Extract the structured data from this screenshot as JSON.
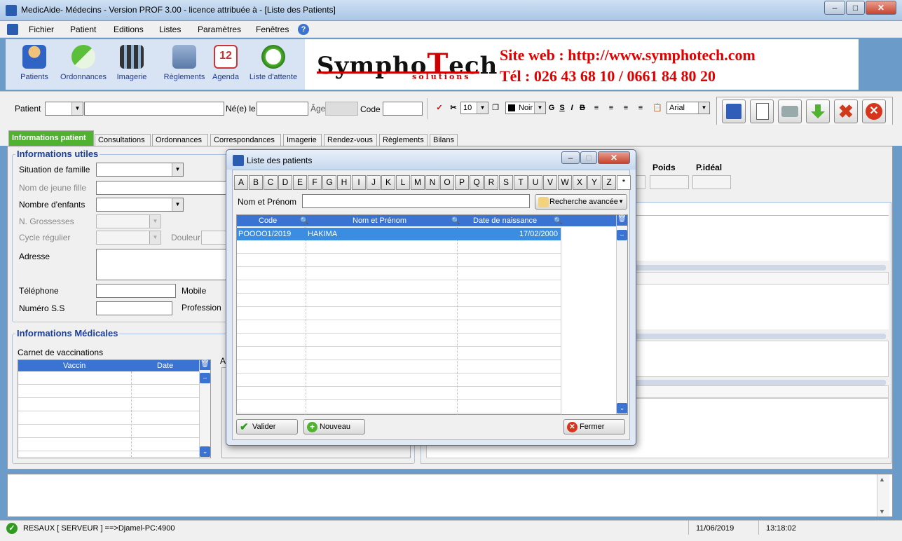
{
  "window": {
    "title": "MedicAide- Médecins - Version PROF 3.00 - licence attribuée à  - [Liste des Patients]"
  },
  "menu": [
    "Fichier",
    "Patient",
    "Editions",
    "Listes",
    "Paramètres",
    "Fenêtres"
  ],
  "toolbar": [
    "Patients",
    "Ordonnances",
    "Imagerie",
    "Règlements",
    "Agenda",
    "Liste d'attente"
  ],
  "banner": {
    "logo_main": "SymphoTech",
    "logo_sub": "solutions",
    "website": "Site web : http://www.symphotech.com",
    "phone": "Tél : 026 43 68 10 / 0661 84 80 20"
  },
  "patient_bar": {
    "patient_label": "Patient",
    "born_label": "Né(e) le",
    "age_label": "Âge",
    "code_label": "Code"
  },
  "format_bar": {
    "font_size": "10",
    "color": "Noir",
    "font": "Arial",
    "bold": "G",
    "underline": "S",
    "italic": "I",
    "strike": "B"
  },
  "tabs": [
    "Informations patient",
    "Consultations",
    "Ordonnances",
    "Correspondances",
    "Imagerie",
    "Rendez-vous",
    "Règlements",
    "Bilans"
  ],
  "info_utiles": {
    "title": "Informations utiles",
    "situation": "Situation de famille",
    "nom_jeune_fille": "Nom de jeune fille",
    "nombre_enfants": "Nombre d'enfants",
    "grossesses": "N. Grossesses",
    "cycle": "Cycle régulier",
    "douleur": "Douleur",
    "adresse": "Adresse",
    "telephone": "Téléphone",
    "mobile": "Mobile",
    "numero_ss": "Numéro S.S",
    "profession": "Profession"
  },
  "right_labels": {
    "poids": "Poids",
    "pideal": "P.idéal"
  },
  "info_medicales": {
    "title": "Informations Médicales",
    "carnet": "Carnet de vaccinations",
    "col_vaccin": "Vaccin",
    "col_date": "Date",
    "a_label": "A"
  },
  "dialog": {
    "title": "Liste des patients",
    "letters": [
      "A",
      "B",
      "C",
      "D",
      "E",
      "F",
      "G",
      "H",
      "I",
      "J",
      "K",
      "L",
      "M",
      "N",
      "O",
      "P",
      "Q",
      "R",
      "S",
      "T",
      "U",
      "V",
      "W",
      "X",
      "Y",
      "Z",
      "*"
    ],
    "search_label": "Nom et Prénom",
    "advanced_label": "Recherche avancée",
    "columns": [
      "Code",
      "Nom et Prénom",
      "Date de naissance"
    ],
    "rows": [
      {
        "code": "POOOO1/2019",
        "name": "HAKIMA",
        "dob": "17/02/2000"
      }
    ],
    "btn_valider": "Valider",
    "btn_nouveau": "Nouveau",
    "btn_fermer": "Fermer"
  },
  "status": {
    "connection": "RESAUX [ SERVEUR ] ==>Djamel-PC:4900",
    "date": "11/06/2019",
    "time": "13:18:02"
  },
  "colors": {
    "accent_blue": "#3a73d1",
    "tab_green": "#4fb32f",
    "banner_red": "#e00000"
  }
}
